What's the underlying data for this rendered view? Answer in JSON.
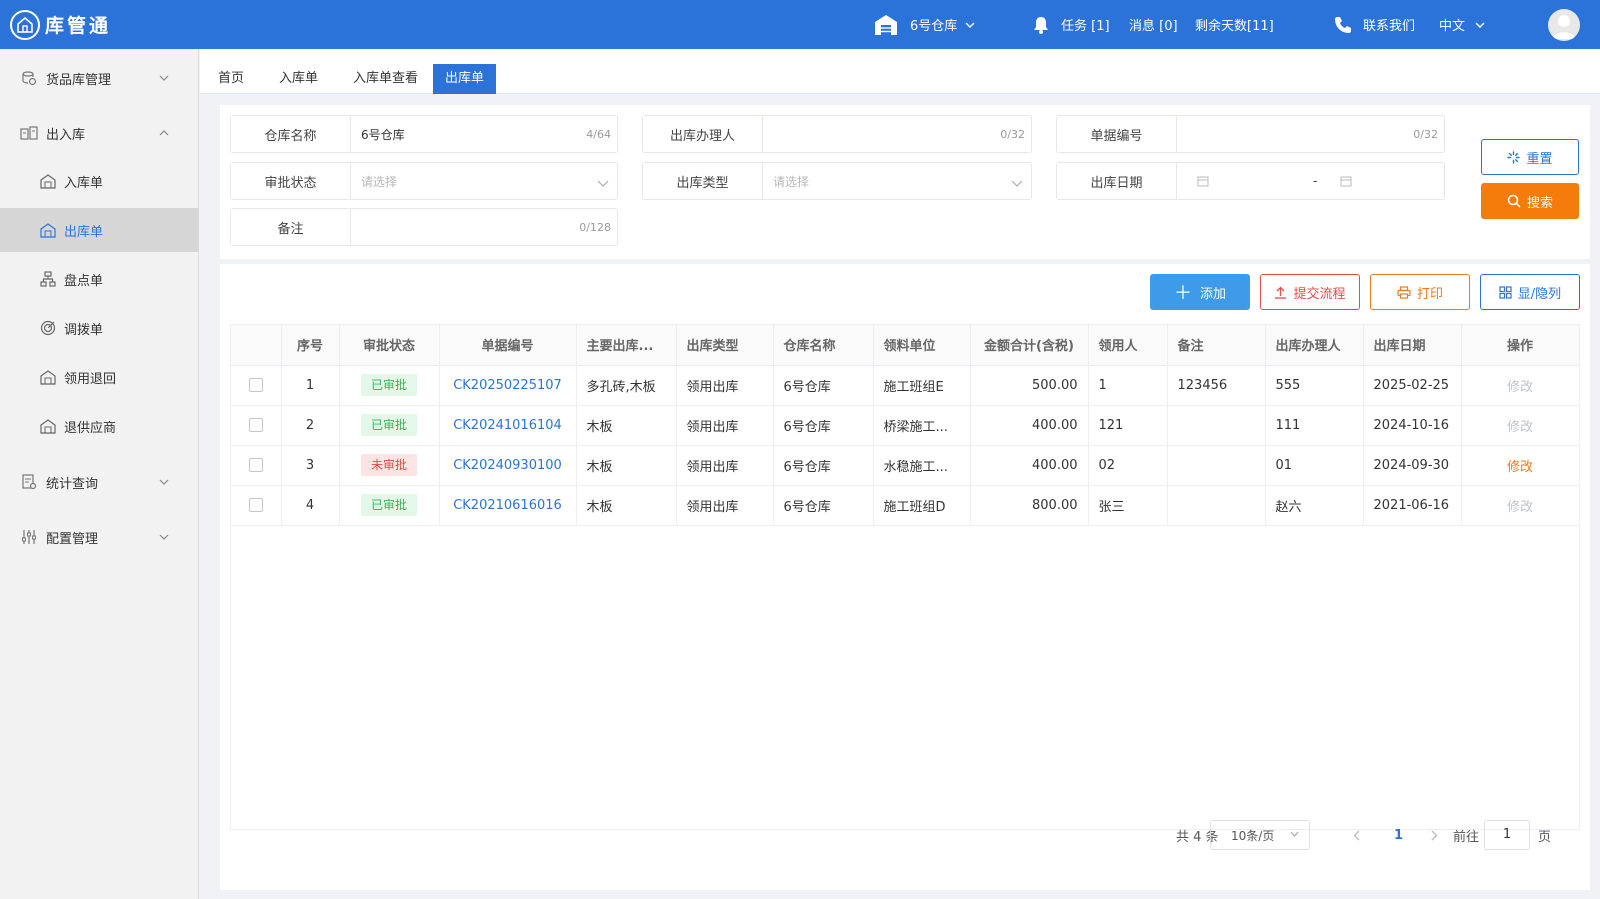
{
  "app": {
    "logo_text": "库管通"
  },
  "header": {
    "warehouse": "6号仓库",
    "tasks": "任务 [1]",
    "messages": "消息 [0]",
    "days_left": "剩余天数[11]",
    "contact": "联系我们",
    "language": "中文"
  },
  "sidebar": {
    "groups": [
      {
        "label": "货品库管理",
        "icon": "goods-icon",
        "expanded": false
      },
      {
        "label": "出入库",
        "icon": "inout-icon",
        "expanded": true
      },
      {
        "label": "统计查询",
        "icon": "stats-icon",
        "expanded": false
      },
      {
        "label": "配置管理",
        "icon": "config-icon",
        "expanded": false
      }
    ],
    "sub_items": [
      {
        "label": "入库单",
        "icon": "warehouse-icon"
      },
      {
        "label": "出库单",
        "icon": "warehouse-icon",
        "active": true
      },
      {
        "label": "盘点单",
        "icon": "org-icon"
      },
      {
        "label": "调拨单",
        "icon": "target-icon"
      },
      {
        "label": "领用退回",
        "icon": "warehouse-icon"
      },
      {
        "label": "退供应商",
        "icon": "warehouse-icon"
      }
    ]
  },
  "tabs": [
    {
      "label": "首页"
    },
    {
      "label": "入库单"
    },
    {
      "label": "入库单查看"
    },
    {
      "label": "出库单",
      "active": true
    }
  ],
  "search": {
    "warehouse_name": {
      "label": "仓库名称",
      "value": "6号仓库",
      "count": "4/64"
    },
    "handler": {
      "label": "出库办理人",
      "value": "",
      "count": "0/32"
    },
    "doc_no": {
      "label": "单据编号",
      "value": "",
      "count": "0/32"
    },
    "approval": {
      "label": "审批状态",
      "placeholder": "请选择"
    },
    "out_type": {
      "label": "出库类型",
      "placeholder": "请选择"
    },
    "out_date": {
      "label": "出库日期",
      "separator": "-"
    },
    "remark": {
      "label": "备注",
      "value": "",
      "count": "0/128"
    },
    "reset_label": "重置",
    "search_label": "搜索"
  },
  "toolbar": {
    "add_label": "添加",
    "submit_label": "提交流程",
    "print_label": "打印",
    "columns_label": "显/隐列"
  },
  "table": {
    "headers": [
      "",
      "序号",
      "审批状态",
      "单据编号",
      "主要出库...",
      "出库类型",
      "仓库名称",
      "领料单位",
      "金额合计(含税)",
      "领用人",
      "备注",
      "出库办理人",
      "出库日期",
      "操作"
    ],
    "rows": [
      {
        "no": "1",
        "status": "已审批",
        "status_type": "ok",
        "doc": "CK20250225107",
        "goods": "多孔砖,木板",
        "type": "领用出库",
        "warehouse": "6号仓库",
        "unit": "施工班组E",
        "amount": "500.00",
        "receiver": "1",
        "remark": "123456",
        "handler": "555",
        "date": "2025-02-25",
        "op": "修改",
        "op_active": false
      },
      {
        "no": "2",
        "status": "已审批",
        "status_type": "ok",
        "doc": "CK20241016104",
        "goods": "木板",
        "type": "领用出库",
        "warehouse": "6号仓库",
        "unit": "桥梁施工...",
        "amount": "400.00",
        "receiver": "121",
        "remark": "",
        "handler": "111",
        "date": "2024-10-16",
        "op": "修改",
        "op_active": false
      },
      {
        "no": "3",
        "status": "未审批",
        "status_type": "no",
        "doc": "CK20240930100",
        "goods": "木板",
        "type": "领用出库",
        "warehouse": "6号仓库",
        "unit": "水稳施工...",
        "amount": "400.00",
        "receiver": "02",
        "remark": "",
        "handler": "01",
        "date": "2024-09-30",
        "op": "修改",
        "op_active": true
      },
      {
        "no": "4",
        "status": "已审批",
        "status_type": "ok",
        "doc": "CK20210616016",
        "goods": "木板",
        "type": "领用出库",
        "warehouse": "6号仓库",
        "unit": "施工班组D",
        "amount": "800.00",
        "receiver": "张三",
        "remark": "",
        "handler": "赵六",
        "date": "2021-06-16",
        "op": "修改",
        "op_active": false
      }
    ]
  },
  "pagination": {
    "total": "共 4 条",
    "page_size": "10条/页",
    "current": "1",
    "goto_prefix": "前往",
    "goto_value": "1",
    "goto_suffix": "页"
  },
  "colors": {
    "primary": "#2b73d9",
    "orange": "#f07a1a",
    "red": "#e54c4c",
    "green": "#3bb25a"
  }
}
